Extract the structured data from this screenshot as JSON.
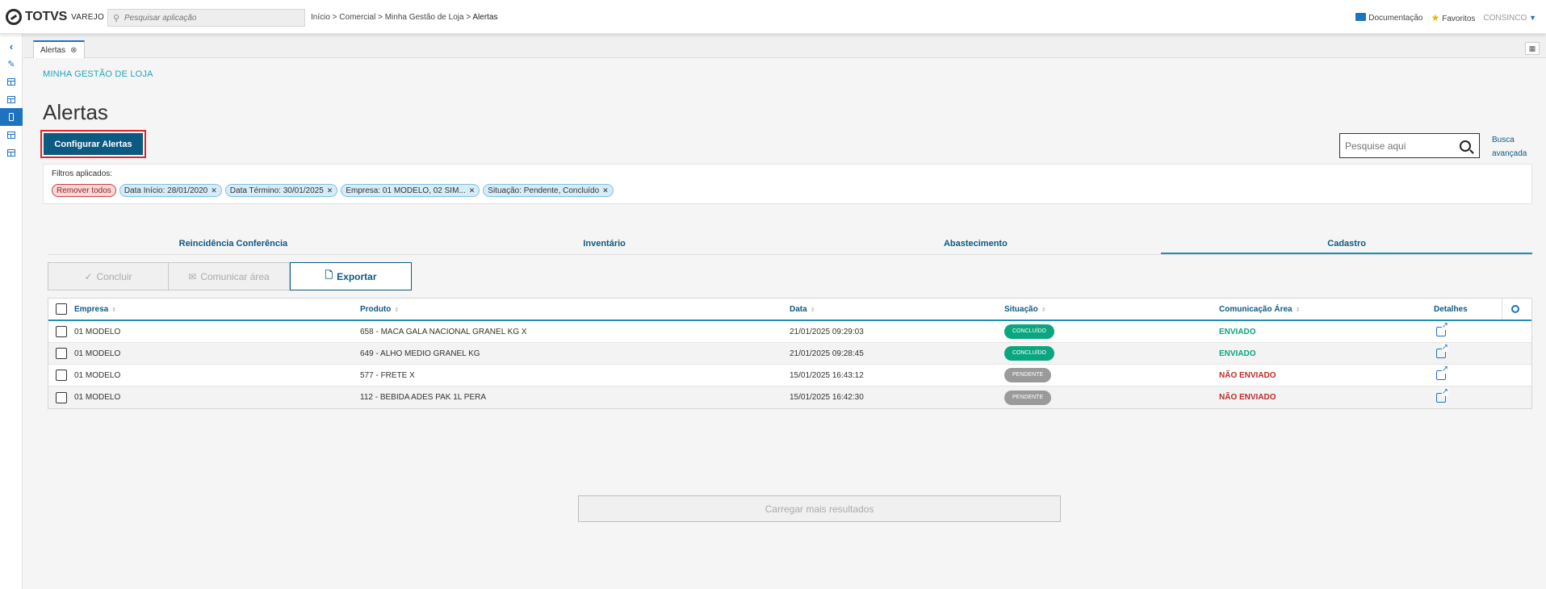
{
  "header": {
    "logo_text": "TOTVS",
    "logo_sub": "VAREJO",
    "search_placeholder": "Pesquisar aplicação",
    "breadcrumb": "Início > Comercial > Minha Gestão de Loja > ",
    "breadcrumb_current": "Alertas",
    "docs_label": "Documentação",
    "favorites_label": "Favoritos",
    "user_label": "CONSINCO"
  },
  "doc_tab": {
    "label": "Alertas"
  },
  "page": {
    "section": "MINHA GESTÃO DE LOJA",
    "title": "Alertas",
    "config_button": "Configurar Alertas",
    "search_placeholder": "Pesquise aqui",
    "advanced_search": "Busca avançada"
  },
  "filters": {
    "label": "Filtros aplicados:",
    "remove_all": "Remover todos",
    "chips": [
      "Data Início: 28/01/2020",
      "Data Término: 30/01/2025",
      "Empresa: 01 MODELO, 02 SIM...",
      "Situação: Pendente, Concluído"
    ]
  },
  "tabs": [
    "Reincidência Conferência",
    "Inventário",
    "Abastecimento",
    "Cadastro"
  ],
  "active_tab": "Cadastro",
  "actions": {
    "concluir": "Concluir",
    "comunicar": "Comunicar área",
    "exportar": "Exportar"
  },
  "table": {
    "columns": [
      "Empresa",
      "Produto",
      "Data",
      "Situação",
      "Comunicação Área",
      "Detalhes"
    ],
    "rows": [
      {
        "empresa": "01 MODELO",
        "produto": "658 - MACA GALA NACIONAL GRANEL KG X",
        "data": "21/01/2025 09:29:03",
        "situacao": "CONCLUÍDO",
        "comunicacao": "ENVIADO"
      },
      {
        "empresa": "01 MODELO",
        "produto": "649 - ALHO MEDIO GRANEL KG",
        "data": "21/01/2025 09:28:45",
        "situacao": "CONCLUÍDO",
        "comunicacao": "ENVIADO"
      },
      {
        "empresa": "01 MODELO",
        "produto": "577 - FRETE X",
        "data": "15/01/2025 16:43:12",
        "situacao": "PENDENTE",
        "comunicacao": "NÃO ENVIADO"
      },
      {
        "empresa": "01 MODELO",
        "produto": "112 - BEBIDA ADES PAK 1L PERA",
        "data": "15/01/2025 16:42:30",
        "situacao": "PENDENTE",
        "comunicacao": "NÃO ENVIADO"
      }
    ]
  },
  "load_more": "Carregar mais resultados",
  "colors": {
    "primary": "#0c5a82",
    "accent": "#1e8fb5",
    "success": "#0aa67f",
    "danger": "#c02a2a",
    "highlight_border": "#e0242b"
  }
}
